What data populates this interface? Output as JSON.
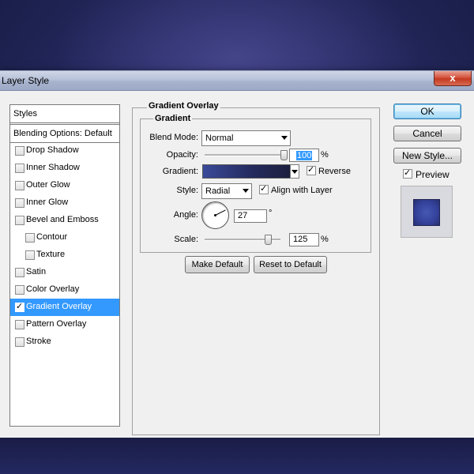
{
  "window": {
    "title": "Layer Style",
    "close_label": "x"
  },
  "styles_list": {
    "header": "Styles",
    "blending": "Blending Options: Default",
    "items": [
      {
        "label": "Drop Shadow",
        "checked": false,
        "indent": false
      },
      {
        "label": "Inner Shadow",
        "checked": false,
        "indent": false
      },
      {
        "label": "Outer Glow",
        "checked": false,
        "indent": false
      },
      {
        "label": "Inner Glow",
        "checked": false,
        "indent": false
      },
      {
        "label": "Bevel and Emboss",
        "checked": false,
        "indent": false
      },
      {
        "label": "Contour",
        "checked": false,
        "indent": true
      },
      {
        "label": "Texture",
        "checked": false,
        "indent": true
      },
      {
        "label": "Satin",
        "checked": false,
        "indent": false
      },
      {
        "label": "Color Overlay",
        "checked": false,
        "indent": false
      },
      {
        "label": "Gradient Overlay",
        "checked": true,
        "indent": false,
        "selected": true
      },
      {
        "label": "Pattern Overlay",
        "checked": false,
        "indent": false
      },
      {
        "label": "Stroke",
        "checked": false,
        "indent": false
      }
    ]
  },
  "gradient_overlay": {
    "section_title": "Gradient Overlay",
    "group_title": "Gradient",
    "blend_mode_label": "Blend Mode:",
    "blend_mode_value": "Normal",
    "opacity_label": "Opacity:",
    "opacity_value": "100",
    "opacity_fraction": 1.0,
    "opacity_unit": "%",
    "gradient_label": "Gradient:",
    "reverse_label": "Reverse",
    "reverse_checked": true,
    "style_label": "Style:",
    "style_value": "Radial",
    "align_label": "Align with Layer",
    "align_checked": true,
    "angle_label": "Angle:",
    "angle_value": "27",
    "angle_unit": "°",
    "scale_label": "Scale:",
    "scale_value": "125",
    "scale_unit": "%",
    "scale_fraction": 0.83,
    "make_default_label": "Make Default",
    "reset_default_label": "Reset to Default"
  },
  "actions": {
    "ok_label": "OK",
    "cancel_label": "Cancel",
    "new_style_label": "New Style...",
    "preview_label": "Preview",
    "preview_checked": true
  },
  "colors": {
    "accent_selected": "#3399ff",
    "gradient_start": "#3a4a9a",
    "gradient_end": "#1c1f3e"
  }
}
